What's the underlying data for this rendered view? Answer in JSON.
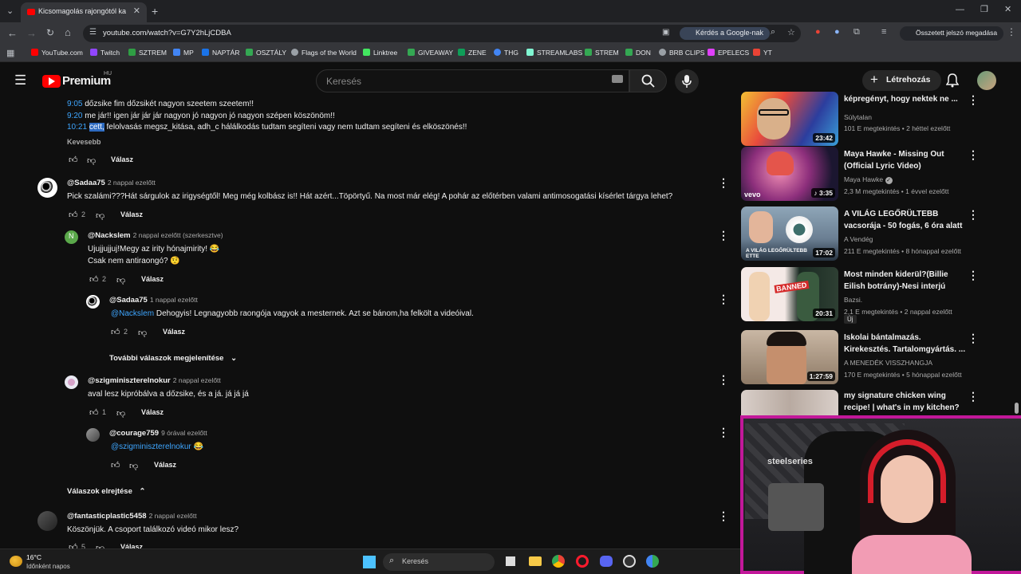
{
  "browser": {
    "tab_title": "Kicsomagolás rajongótól kapott",
    "url": "youtube.com/watch?v=G7Y2hLjCDBA",
    "ask_google": "Kérdés a Google-nak",
    "password_manager": "Összetett jelszó megadása",
    "bookmarks": [
      "YouTube.com",
      "Twitch",
      "SZTREM",
      "MP",
      "NAPTÁR",
      "OSZTÁLY",
      "Flags of the World",
      "Linktree",
      "GIVEAWAY",
      "ZENE",
      "THG",
      "STREAMLABS",
      "STREM",
      "DON",
      "BRB CLIPS",
      "EPELECS",
      "YT"
    ]
  },
  "youtube": {
    "logo": "Premium",
    "region": "HU",
    "search_placeholder": "Keresés",
    "create_label": "Létrehozás"
  },
  "comment_top": {
    "lines": [
      {
        "ts": "9:05",
        "text": " dőzsike fim dőzsikét nagyon szeetem szeetem!!"
      },
      {
        "ts": "9:20",
        "text": " me jár!! igen jár jár jár nagyon jó nagyon jó nagyon szépen köszönöm!!"
      },
      {
        "ts": "10:21",
        "highlight": "cett,",
        "text": " felolvasás megsz_kitása, adh_c hálálkodás tudtam segíteni vagy nem tudtam segíteni és elköszönés!!"
      }
    ],
    "less": "Kevesebb",
    "reply": "Válasz"
  },
  "comments": [
    {
      "author": "@Sadaa75",
      "time": "2 nappal ezelőtt",
      "text": "Pick szalámi???Hát sárgulok az irigységtől! Meg még kolbász is!! Hát azért...Töpörtyű. Na most már elég! A pohár az előtérben valami antimosogatási kísérlet tárgya lehet?",
      "likes": "2",
      "reply": "Válasz"
    },
    {
      "author": "@Nackslem",
      "time": "2 nappal ezelőtt (szerkesztve)",
      "text1": "Ujujjujjuj!Megy az irity hónajmirity! 😂",
      "text2": "Csak nem antiraongó? 🤨",
      "likes": "2",
      "reply": "Válasz",
      "avatar_letter": "N"
    },
    {
      "author": "@Sadaa75",
      "time": "1 nappal ezelőtt",
      "mention": "@Nackslem",
      "text": "  Dehogyis! Legnagyobb raongója vagyok a mesternek. Azt se bánom,ha felkölt a videóival.",
      "likes": "2",
      "reply": "Válasz"
    },
    {
      "author": "@szigminiszterelnokur",
      "time": "2 nappal ezelőtt",
      "text": "aval lesz kipróbálva a dőzsike, és a já. já já já",
      "likes": "1",
      "reply": "Válasz"
    },
    {
      "author": "@courage759",
      "time": "9 órával ezelőtt",
      "mention": "@szigminiszterelnokur",
      "text": " 😂",
      "reply": "Válasz"
    },
    {
      "author": "@fantasticplastic5458",
      "time": "2 nappal ezelőtt",
      "text": "Köszönjük. A csoport találkozó videó mikor lesz?",
      "likes": "5",
      "reply": "Válasz"
    }
  ],
  "more_replies": "További válaszok megjelenítése",
  "hide_replies": "Válaszok elrejtése",
  "sidebar": [
    {
      "title1": "képregényt, hogy nektek ne ...",
      "title2": "",
      "channel": "Súlytalan",
      "meta": "101 E megtekintés • 2 héttel ezelőtt",
      "duration": "23:42"
    },
    {
      "title1": "Maya Hawke - Missing Out",
      "title2": "(Official Lyric Video)",
      "channel": "Maya Hawke",
      "meta": "2,3 M megtekintés • 1 évvel ezelőtt",
      "duration": "3:35",
      "thumb_label": "vevo"
    },
    {
      "title1": "A VILÁG LEGŐRÜLTEBB",
      "title2": "vacsorája - 50 fogás, 6 óra alatt",
      "channel": "A Vendég",
      "meta": "211 E megtekintés • 8 hónappal ezelőtt",
      "duration": "17:02",
      "thumb_label": "A VILÁG LEGŐRÜLTEBB ETTE"
    },
    {
      "title1": "Most minden kiderül?(Billie",
      "title2": "Eilish botrány)-Nesi interjú",
      "channel": "Bazsi.",
      "meta": "2,1 E megtekintés • 2 nappal ezelőtt",
      "badge": "Új",
      "duration": "20:31",
      "thumb_label": "BANNED"
    },
    {
      "title1": "Iskolai bántalmazás.",
      "title2": "Kirekesztés. Tartalomgyártás. ...",
      "channel": "A MENEDÉK VISSZHANGJA",
      "meta": "170 E megtekintés • 5 hónappal ezelőtt",
      "duration": "1:27:59"
    },
    {
      "title1": "my signature chicken wing",
      "title2": "recipe! | what's in my kitchen?",
      "channel": "",
      "meta": ""
    }
  ],
  "taskbar": {
    "temp": "16°C",
    "weather": "Időnként napos",
    "search": "Keresés"
  },
  "webcam": {
    "brand": "steelseries"
  },
  "colors": {
    "link": "#3ea6ff",
    "bg": "#0f0f0f",
    "accent": "#ff0000"
  }
}
